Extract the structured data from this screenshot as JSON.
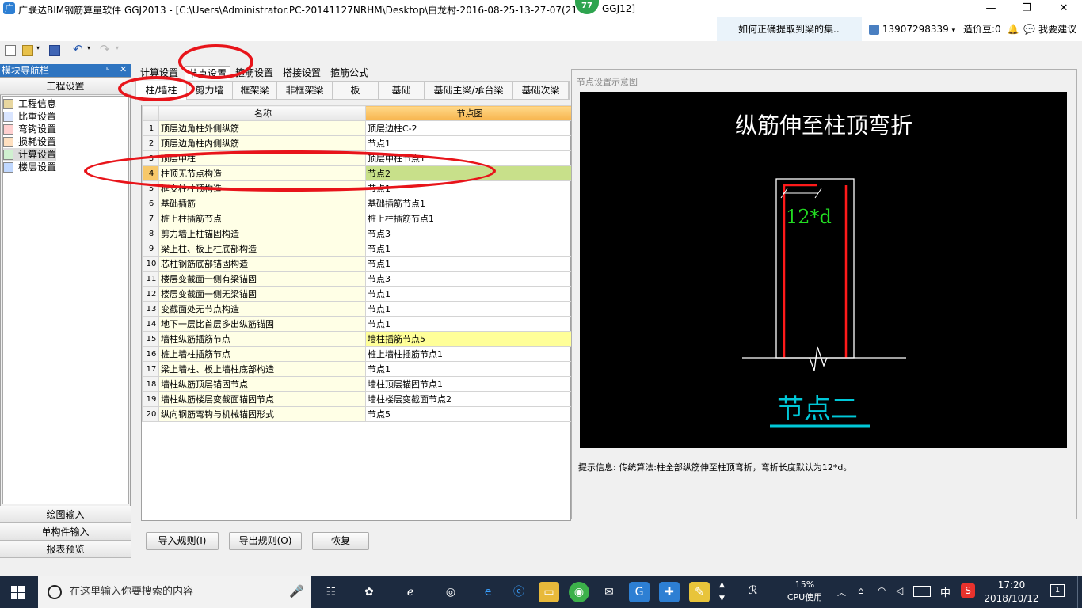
{
  "window": {
    "title": "广联达BIM钢筋算量软件 GGJ2013 - [C:\\Users\\Administrator.PC-20141127NRHM\\Desktop\\白龙村-2016-08-25-13-27-07(21",
    "title_tail": "GGJ12]",
    "badge": "77",
    "min": "—",
    "max": "❐",
    "close": "✕"
  },
  "infobar": {
    "tip": "如何正确提取到梁的集..",
    "phone": "13907298339",
    "bean": "造价豆:0",
    "suggest": "我要建议"
  },
  "nav": {
    "header": "模块导航栏",
    "pin": "ᵖ",
    "close": "✕",
    "section_top": "工程设置",
    "items": [
      "工程信息",
      "比重设置",
      "弯钩设置",
      "损耗设置",
      "计算设置",
      "楼层设置"
    ],
    "bottom": [
      "绘图输入",
      "单构件输入",
      "报表预览"
    ]
  },
  "tabs": [
    "计算设置",
    "节点设置",
    "箍筋设置",
    "搭接设置",
    "箍筋公式"
  ],
  "subtabs": [
    "柱/墙柱",
    "剪力墙",
    "框架梁",
    "非框架梁",
    "板",
    "基础",
    "基础主梁/承台梁",
    "基础次梁"
  ],
  "grid": {
    "col_name": "名称",
    "col_node": "节点图",
    "rows": [
      {
        "n": "1",
        "name": "顶层边角柱外侧纵筋",
        "node": "顶层边柱C-2"
      },
      {
        "n": "2",
        "name": "顶层边角柱内侧纵筋",
        "node": "节点1"
      },
      {
        "n": "3",
        "name": "顶层中柱",
        "node": "顶层中柱节点1"
      },
      {
        "n": "4",
        "name": "柱顶无节点构造",
        "node": "节点2"
      },
      {
        "n": "5",
        "name": "框支柱柱顶构造",
        "node": "节点1"
      },
      {
        "n": "6",
        "name": "基础插筋",
        "node": "基础插筋节点1"
      },
      {
        "n": "7",
        "name": "桩上柱插筋节点",
        "node": "桩上柱插筋节点1"
      },
      {
        "n": "8",
        "name": "剪力墙上柱锚固构造",
        "node": "节点3"
      },
      {
        "n": "9",
        "name": "梁上柱、板上柱底部构造",
        "node": "节点1"
      },
      {
        "n": "10",
        "name": "芯柱钢筋底部锚固构造",
        "node": "节点1"
      },
      {
        "n": "11",
        "name": "楼层变截面一侧有梁锚固",
        "node": "节点3"
      },
      {
        "n": "12",
        "name": "楼层变截面一侧无梁锚固",
        "node": "节点1"
      },
      {
        "n": "13",
        "name": "变截面处无节点构造",
        "node": "节点1"
      },
      {
        "n": "14",
        "name": "地下一层比首层多出纵筋锚固",
        "node": "节点1"
      },
      {
        "n": "15",
        "name": "墙柱纵筋插筋节点",
        "node": "墙柱插筋节点5"
      },
      {
        "n": "16",
        "name": "桩上墙柱插筋节点",
        "node": "桩上墙柱插筋节点1"
      },
      {
        "n": "17",
        "name": "梁上墙柱、板上墙柱底部构造",
        "node": "节点1"
      },
      {
        "n": "18",
        "name": "墙柱纵筋顶层锚固节点",
        "node": "墙柱顶层锚固节点1"
      },
      {
        "n": "19",
        "name": "墙柱纵筋楼层变截面锚固节点",
        "node": "墙柱楼层变截面节点2"
      },
      {
        "n": "20",
        "name": "纵向钢筋弯钩与机械锚固形式",
        "node": "节点5"
      }
    ]
  },
  "preview": {
    "panel_title": "节点设置示意图",
    "diagram_title": "纵筋伸至柱顶弯折",
    "dim_label": "12*d",
    "node_label": "节点二",
    "hint": "提示信息:  传统算法:柱全部纵筋伸至柱顶弯折，弯折长度默认为12*d。"
  },
  "buttons": {
    "import": "导入规则(I)",
    "export": "导出规则(O)",
    "restore": "恢复"
  },
  "taskbar": {
    "search": "在这里输入你要搜索的内容",
    "cpu_pct": "15%",
    "cpu_label": "CPU使用",
    "ime": "中",
    "time": "17:20",
    "date": "2018/10/12",
    "notif": "1"
  },
  "colors": {
    "accent": "#2e74c0",
    "annotation": "#e8141a",
    "diagram_title": "#ffffff",
    "dim": "#22dd22",
    "node_label": "#00c8d8",
    "rebar": "#ff1a1a"
  }
}
